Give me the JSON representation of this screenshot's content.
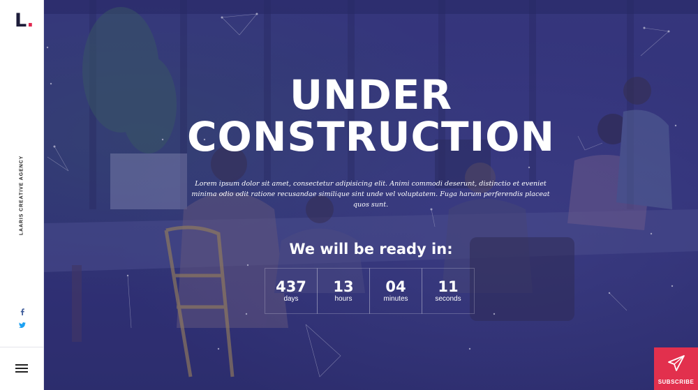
{
  "sidebar": {
    "logo_letter": "L",
    "logo_dot": ".",
    "vertical_text": "LAARIS CREATIVE AGENCY",
    "social": [
      "facebook-icon",
      "twitter-icon"
    ],
    "menu_icon": "hamburger-icon"
  },
  "hero": {
    "title_line1": "UNDER",
    "title_line2": "CONSTRUCTION",
    "description": "Lorem ipsum dolor sit amet, consectetur adipisicing elit. Animi commodi deserunt, distinctio et eveniet minima odio odit ratione recusandae similique sint unde vel voluptatem. Fuga harum perferendis placeat quos sunt.",
    "ready_text": "We will be ready in:"
  },
  "countdown": [
    {
      "value": "437",
      "label": "days"
    },
    {
      "value": "13",
      "label": "hours"
    },
    {
      "value": "04",
      "label": "minutes"
    },
    {
      "value": "11",
      "label": "seconds"
    }
  ],
  "subscribe": {
    "label": "SUBSCRIBE",
    "icon": "paper-plane-icon"
  },
  "colors": {
    "accent": "#e2304d",
    "overlay": "#2e2f6e",
    "logo_dot": "#e0284f"
  }
}
